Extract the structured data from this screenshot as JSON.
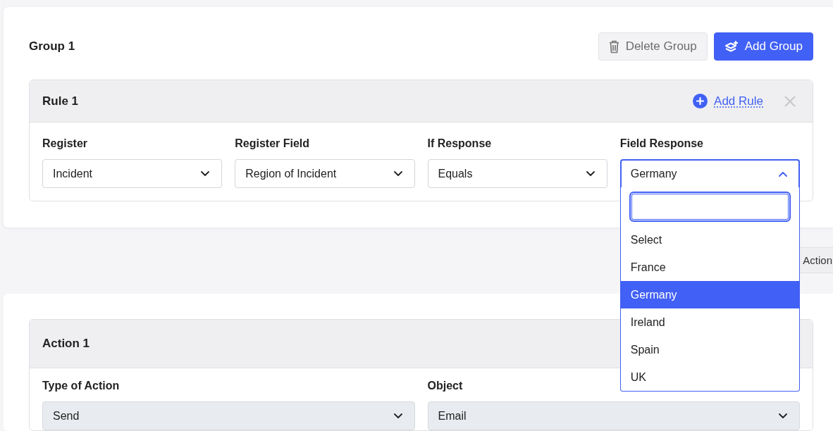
{
  "group": {
    "title": "Group 1",
    "buttons": [
      {
        "label": "Delete Group",
        "kind": "secondary",
        "disabled": true
      },
      {
        "label": "Add Group",
        "kind": "primary",
        "disabled": false
      }
    ],
    "rule": {
      "title": "Rule 1",
      "add_link": "Add Rule",
      "fields": [
        {
          "label": "Register",
          "value": "Incident",
          "expanded": false
        },
        {
          "label": "Register Field",
          "value": "Region of Incident",
          "expanded": false
        },
        {
          "label": "If Response",
          "value": "Equals",
          "expanded": false
        },
        {
          "label": "Field Response",
          "value": "Germany",
          "expanded": true,
          "options": [
            {
              "label": "Select",
              "selected": false
            },
            {
              "label": "France",
              "selected": false
            },
            {
              "label": "Germany",
              "selected": true
            },
            {
              "label": "Ireland",
              "selected": false
            },
            {
              "label": "Spain",
              "selected": false
            },
            {
              "label": "UK",
              "selected": false
            }
          ]
        }
      ]
    }
  },
  "action_button": {
    "label": "Action"
  },
  "action": {
    "title": "Action 1",
    "fields": [
      {
        "label": "Type of Action",
        "value": "Send",
        "expanded": false,
        "disabled": true
      },
      {
        "label": "Object",
        "value": "Email",
        "expanded": false,
        "disabled": true
      }
    ]
  }
}
